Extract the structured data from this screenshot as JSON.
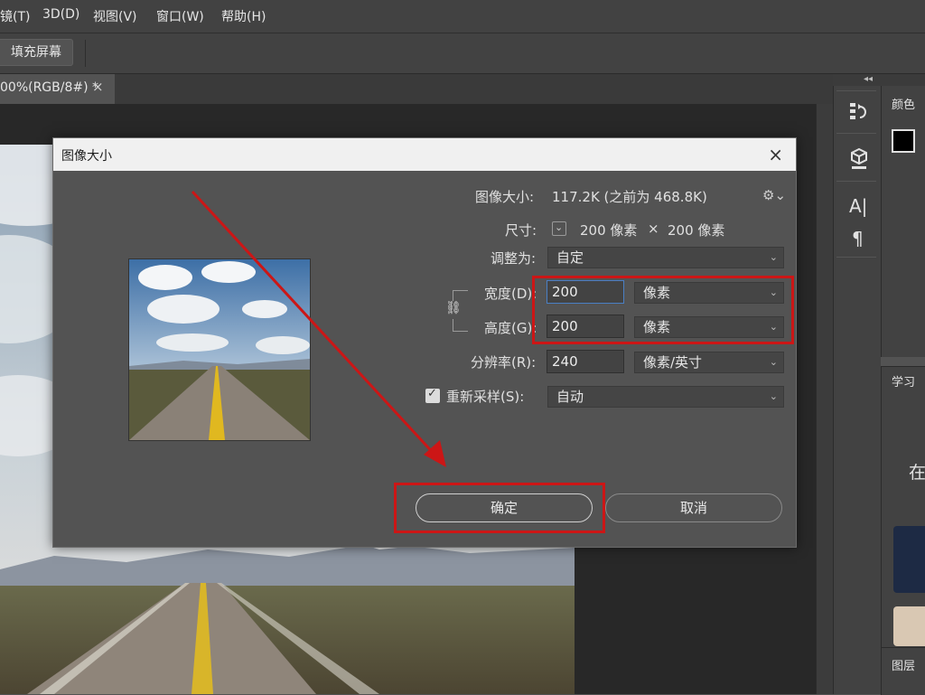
{
  "menu": {
    "items": [
      "镜(T)",
      "3D(D)",
      "视图(V)",
      "窗口(W)",
      "帮助(H)"
    ]
  },
  "options_bar": {
    "fill_screen_label": "填充屏幕"
  },
  "tab": {
    "title": "00%(RGB/8#) *",
    "close": "×"
  },
  "panels": {
    "color_title": "颜色",
    "learn_title": "学习",
    "learn_text": "在",
    "layers_title": "图层"
  },
  "dialog": {
    "title": "图像大小",
    "close": "×",
    "image_size_label": "图像大小:",
    "image_size_value": "117.2K (之前为 468.8K)",
    "dimensions_label": "尺寸:",
    "dimensions_width": "200 像素",
    "dimensions_times": "×",
    "dimensions_height": "200 像素",
    "fit_to_label": "调整为:",
    "fit_to_value": "自定",
    "width_label": "宽度(D):",
    "width_value": "200",
    "width_unit": "像素",
    "height_label": "高度(G):",
    "height_value": "200",
    "height_unit": "像素",
    "resolution_label": "分辨率(R):",
    "resolution_value": "240",
    "resolution_unit": "像素/英寸",
    "resample_label": "重新采样(S):",
    "resample_checked": true,
    "resample_value": "自动",
    "ok_label": "确定",
    "cancel_label": "取消"
  },
  "colors": {
    "annotation_red": "#cc1616",
    "dialog_bg": "#535353",
    "ui_dark": "#424242"
  }
}
